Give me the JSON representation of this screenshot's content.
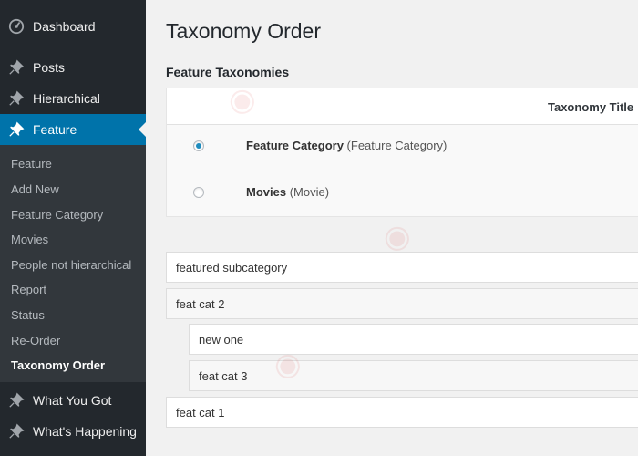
{
  "sidebar": {
    "menu": [
      {
        "label": "Dashboard",
        "icon": "dashboard-icon"
      },
      {
        "label": "Posts",
        "icon": "pin-icon"
      },
      {
        "label": "Hierarchical",
        "icon": "pin-icon"
      },
      {
        "label": "Feature",
        "icon": "pin-icon",
        "active": true
      },
      {
        "label": "What You Got",
        "icon": "pin-icon"
      },
      {
        "label": "What's Happening",
        "icon": "pin-icon"
      }
    ],
    "submenu": [
      "Feature",
      "Add New",
      "Feature Category",
      "Movies",
      "People not hierarchical",
      "Report",
      "Status",
      "Re-Order",
      "Taxonomy Order"
    ],
    "submenu_current": "Taxonomy Order"
  },
  "main": {
    "title": "Taxonomy Order",
    "section_title": "Feature Taxonomies",
    "table": {
      "column_title": "Taxonomy Title",
      "rows": [
        {
          "name": "Feature Category",
          "detail": "(Feature Category)",
          "selected": true
        },
        {
          "name": "Movies",
          "detail": "(Movie)",
          "selected": false
        }
      ]
    },
    "terms": [
      {
        "label": "featured subcategory",
        "level": 0
      },
      {
        "label": "feat cat 2",
        "level": 0
      },
      {
        "label": "new one",
        "level": 1
      },
      {
        "label": "feat cat 3",
        "level": 1
      },
      {
        "label": "feat cat 1",
        "level": 0
      }
    ]
  },
  "colors": {
    "sidebar_bg": "#23282d",
    "submenu_bg": "#32373c",
    "accent": "#0073aa"
  }
}
